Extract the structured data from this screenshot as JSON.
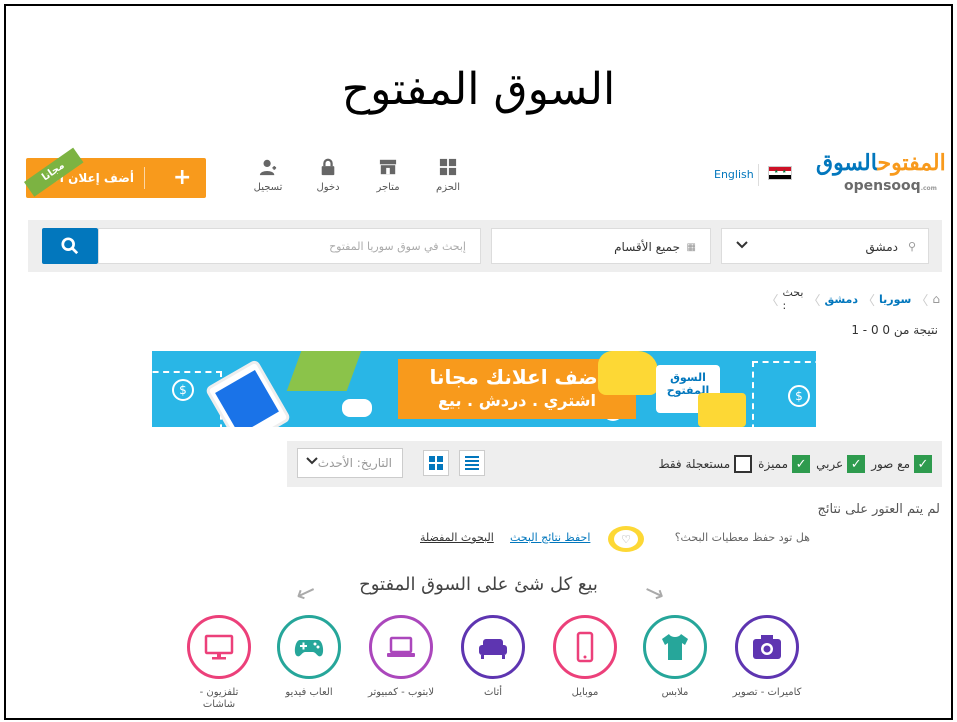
{
  "slide_title": "السوق المفتوح",
  "header": {
    "post_button": "أضف إعلان الآن",
    "free_ribbon": "مجانا",
    "nav": [
      {
        "label": "الحزم",
        "icon": "packages-icon"
      },
      {
        "label": "متاجر",
        "icon": "store-icon"
      },
      {
        "label": "دخول",
        "icon": "lock-icon"
      },
      {
        "label": "تسجيل",
        "icon": "add-user-icon"
      }
    ],
    "language": "English",
    "logo_ar_a": "السوق",
    "logo_ar_b": "المفتوح",
    "logo_en": "opensooq",
    "logo_en_suffix": ".com"
  },
  "search": {
    "placeholder": "إبحث في سوق سوريا المفتوح",
    "category": "جميع الأقسام",
    "city": "دمشق"
  },
  "breadcrumb": {
    "country": "سوريا",
    "city": "دمشق",
    "current": "بحث :"
  },
  "result_count": "1 - 0 نتيجة من 0",
  "banner": {
    "headline": "اضف اعلانك مجانا",
    "subline": "اشتري . دردش . بيع",
    "logo_text": "السوق المفتوح"
  },
  "filters": {
    "sort_label": "التاريخ: الأحدث",
    "checkboxes": [
      {
        "label": "مع صور",
        "checked": true
      },
      {
        "label": "عربي",
        "checked": true
      },
      {
        "label": "مميزة",
        "checked": true
      },
      {
        "label": "مستعجلة فقط",
        "checked": false
      }
    ]
  },
  "no_results": "لم يتم العتور على نتائج",
  "save_search": {
    "question": "هل تود حفظ معطيات البحث؟",
    "save_link": "احفظ نتائج البحث",
    "fav_link": "البحوث المفضلة"
  },
  "sell_heading": "بيع كل شئ على السوق المفتوح",
  "categories": [
    {
      "label": "كاميرات - تصوير",
      "icon": "camera-icon",
      "color": "#5e35b1"
    },
    {
      "label": "ملابس",
      "icon": "tshirt-icon",
      "color": "#26a69a"
    },
    {
      "label": "موبايل",
      "icon": "mobile-icon",
      "color": "#ec407a"
    },
    {
      "label": "أثاث",
      "icon": "sofa-icon",
      "color": "#5e35b1"
    },
    {
      "label": "لابتوب - كمبيوتر",
      "icon": "laptop-icon",
      "color": "#ab47bc"
    },
    {
      "label": "العاب فيديو",
      "icon": "gamepad-icon",
      "color": "#26a69a"
    },
    {
      "label": "تلفزيون - شاشات",
      "icon": "tv-icon",
      "color": "#ec407a"
    }
  ],
  "colors": {
    "brand_blue": "#0277bd",
    "brand_orange": "#f89a1c",
    "check_green": "#2e9b4e"
  }
}
